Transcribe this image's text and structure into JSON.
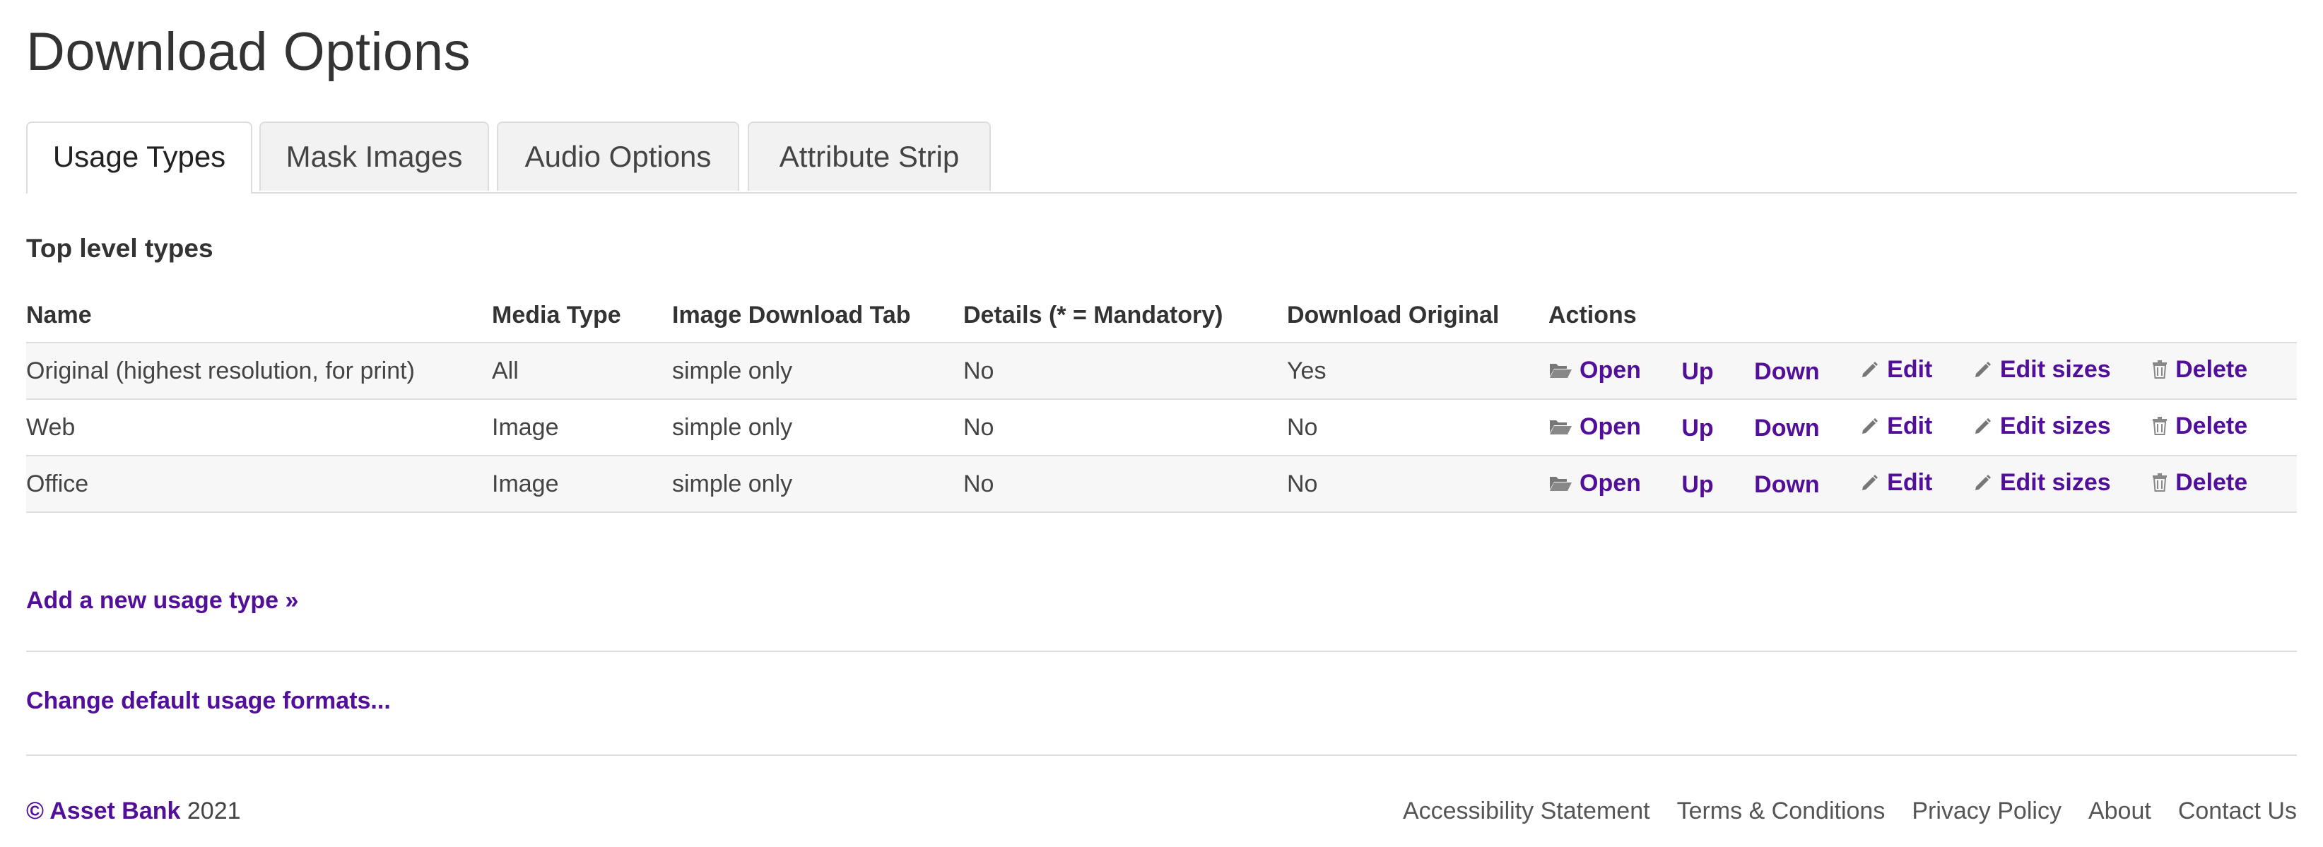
{
  "page": {
    "title": "Download Options"
  },
  "tabs": [
    {
      "label": "Usage Types",
      "active": true
    },
    {
      "label": "Mask Images",
      "active": false
    },
    {
      "label": "Audio Options",
      "active": false
    },
    {
      "label": "Attribute Strip",
      "active": false
    }
  ],
  "section": {
    "title": "Top level types"
  },
  "table": {
    "headers": [
      "Name",
      "Media Type",
      "Image Download Tab",
      "Details (* = Mandatory)",
      "Download Original",
      "Actions"
    ],
    "rows": [
      {
        "name": "Original (highest resolution, for print)",
        "media_type": "All",
        "download_tab": "simple only",
        "details": "No",
        "download_original": "Yes"
      },
      {
        "name": "Web",
        "media_type": "Image",
        "download_tab": "simple only",
        "details": "No",
        "download_original": "No"
      },
      {
        "name": "Office",
        "media_type": "Image",
        "download_tab": "simple only",
        "details": "No",
        "download_original": "No"
      }
    ],
    "actions": {
      "open": "Open",
      "up": "Up",
      "down": "Down",
      "edit": "Edit",
      "edit_sizes": "Edit sizes",
      "delete": "Delete"
    }
  },
  "links": {
    "add_usage_type": "Add a new usage type »",
    "change_formats": "Change default usage formats..."
  },
  "footer": {
    "copyright_brand": "© Asset Bank",
    "year": "2021",
    "links": [
      "Accessibility Statement",
      "Terms & Conditions",
      "Privacy Policy",
      "About",
      "Contact Us"
    ]
  },
  "colors": {
    "link": "#52109a",
    "text": "#333333",
    "border": "#dddddd",
    "row_stripe": "#f7f7f7"
  },
  "icons": {
    "open": "folder-open-icon",
    "edit": "pencil-icon",
    "edit_sizes": "pencil-icon",
    "delete": "trash-icon"
  }
}
